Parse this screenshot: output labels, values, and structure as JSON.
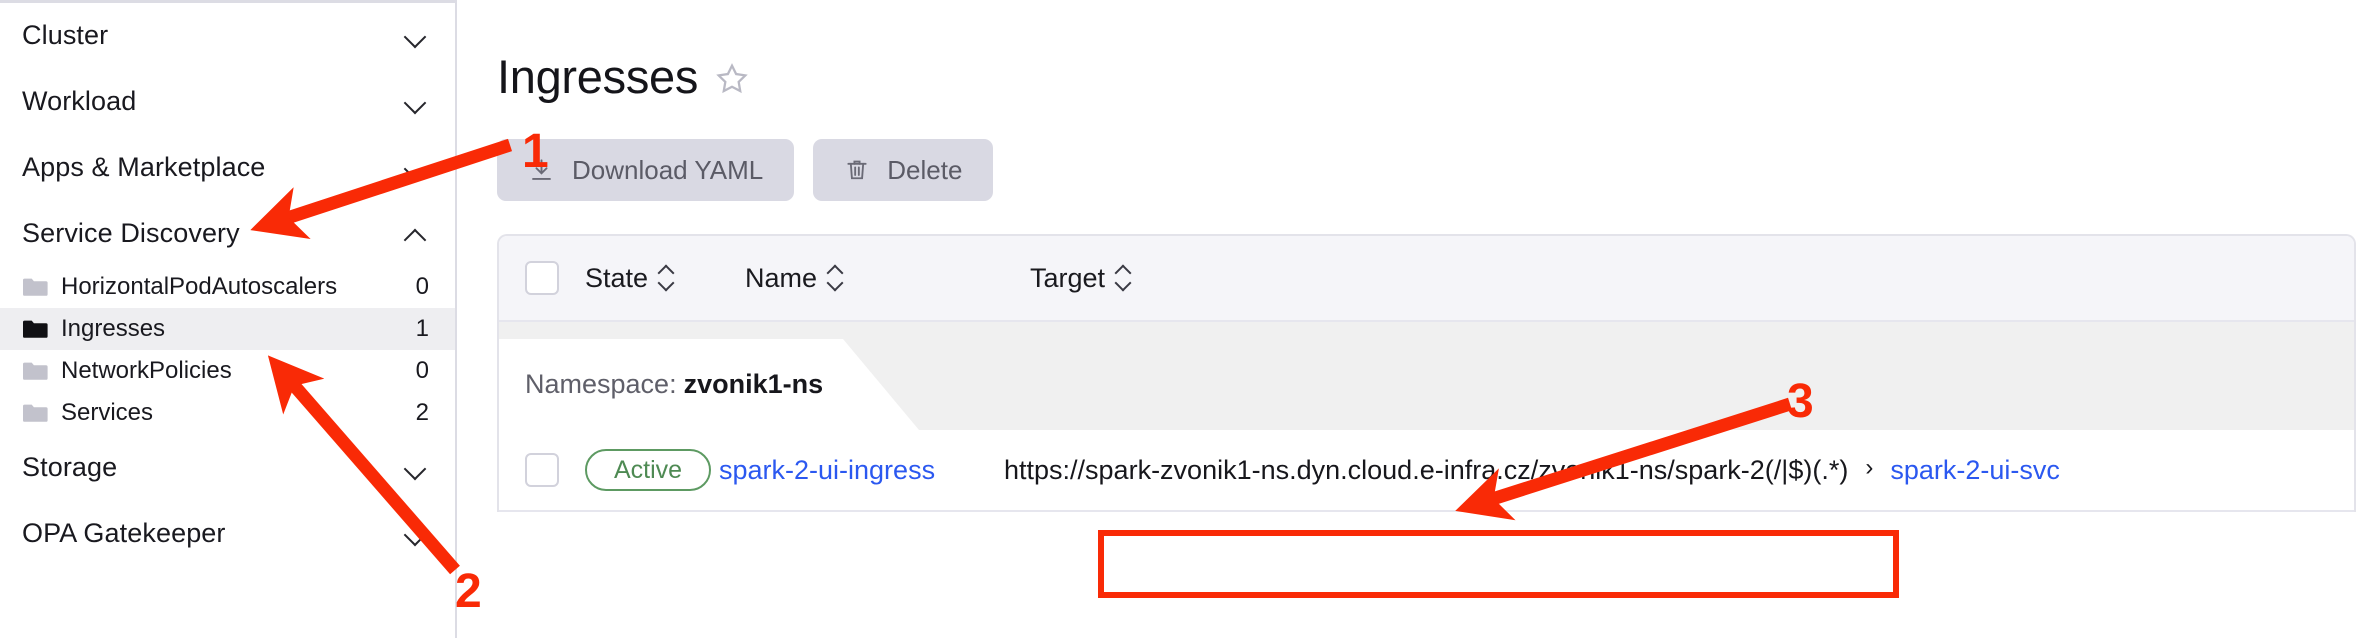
{
  "sidebar": {
    "groups": [
      {
        "label": "Cluster",
        "chevron": "chevron-down-icon"
      },
      {
        "label": "Workload",
        "chevron": "chevron-down-icon"
      },
      {
        "label": "Apps & Marketplace",
        "chevron": "chevron-down-icon"
      },
      {
        "label": "Service Discovery",
        "chevron": "chevron-up-icon"
      }
    ],
    "items": [
      {
        "label": "HorizontalPodAutoscalers",
        "count": "0",
        "icon": "folder-icon",
        "active": false
      },
      {
        "label": "Ingresses",
        "count": "1",
        "icon": "folder-icon",
        "active": true
      },
      {
        "label": "NetworkPolicies",
        "count": "0",
        "icon": "folder-icon",
        "active": false
      },
      {
        "label": "Services",
        "count": "2",
        "icon": "folder-icon",
        "active": false
      }
    ],
    "groups_after": [
      {
        "label": "Storage",
        "chevron": "chevron-down-icon"
      },
      {
        "label": "OPA Gatekeeper",
        "chevron": "chevron-down-icon"
      }
    ]
  },
  "main": {
    "page_title": "Ingresses",
    "favorite_icon": "star-outline-icon",
    "toolbar": {
      "download_label": "Download YAML",
      "download_icon": "download-icon",
      "delete_label": "Delete",
      "delete_icon": "trash-icon"
    },
    "table": {
      "headers": {
        "state": "State",
        "name": "Name",
        "target": "Target"
      },
      "group_label": "Namespace:",
      "group_value": "zvonik1-ns",
      "rows": [
        {
          "state": "Active",
          "name": "spark-2-ui-ingress",
          "target_url": "https://spark-zvonik1-ns.dyn.cloud.e-infra.cz/zvonik1-ns/spark-2(/|$)(.*)",
          "target_separator": "›",
          "target_service": "spark-2-ui-svc"
        }
      ]
    }
  },
  "annotations": {
    "color": "#f92a06",
    "markers": [
      {
        "number": "1",
        "target": "Service Discovery sidebar group"
      },
      {
        "number": "2",
        "target": "Ingresses sidebar item"
      },
      {
        "number": "3",
        "target": "Target URL of spark-2-ui-ingress"
      }
    ],
    "highlight_box": "target-url-red-box"
  }
}
